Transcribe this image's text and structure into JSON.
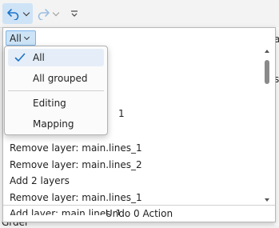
{
  "toolbar": {
    "undo_icon": "undo-icon",
    "redo_icon": "redo-icon",
    "customize_icon": "customize-icon",
    "accent": "#1a73c8",
    "active_bg": "#cfe3f7"
  },
  "background": {
    "left_fragment": "Grder",
    "right_fragment_a": "a",
    "right_fragment_b": "s"
  },
  "popup": {
    "filter_value": "All",
    "undo_status": "Undo 0 Action",
    "history": [
      "Remove layer: main.lines_1",
      "Remove layer: main.lines_2",
      "Add 2 layers",
      "Remove layer: main.lines_1",
      "Add layer: main.lines_1"
    ]
  },
  "menu": {
    "items": [
      {
        "label": "All",
        "checked": true
      },
      {
        "label": "All grouped",
        "checked": false
      },
      {
        "label": "Editing",
        "checked": false
      },
      {
        "label": "Mapping",
        "checked": false
      }
    ],
    "peek_fragment": "1"
  }
}
